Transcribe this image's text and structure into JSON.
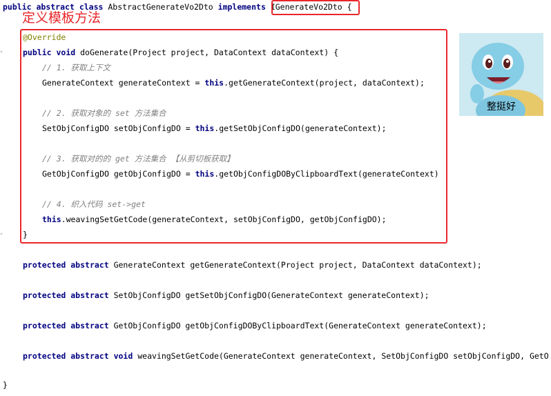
{
  "header": {
    "kw_public": "public",
    "kw_abstract": "abstract",
    "kw_class": "class",
    "class_name": "AbstractGenerateVo2Dto",
    "kw_implements": "implements",
    "interface_name": "IGenerateVo2Dto {"
  },
  "annotation_label": "定义模板方法",
  "method": {
    "override": "@Override",
    "kw_public": "public",
    "kw_void": "void",
    "signature": "doGenerate(Project project, DataContext dataContext) {",
    "comment1": "// 1. 获取上下文",
    "line1_type": "GenerateContext generateContext = ",
    "line1_this": "this",
    "line1_rest": ".getGenerateContext(project, dataContext);",
    "comment2": "// 2. 获取对象的 set 方法集合",
    "line2_type": "SetObjConfigDO setObjConfigDO = ",
    "line2_this": "this",
    "line2_rest": ".getSetObjConfigDO(generateContext);",
    "comment3": "// 3. 获取对的的 get 方法集合 【从剪切板获取】",
    "line3_type": "GetObjConfigDO getObjConfigDO = ",
    "line3_this": "this",
    "line3_rest": ".getObjConfigDOByClipboardText(generateContext)",
    "comment4": "// 4. 织入代码 set->get",
    "line4_this": "this",
    "line4_rest": ".weavingSetGetCode(generateContext, setObjConfigDO, getObjConfigDO);",
    "close": "}"
  },
  "abstract_methods": [
    {
      "kw1": "protected",
      "kw2": "abstract",
      "rest": "GenerateContext getGenerateContext(Project project, DataContext dataContext);"
    },
    {
      "kw1": "protected",
      "kw2": "abstract",
      "rest": "SetObjConfigDO getSetObjConfigDO(GenerateContext generateContext);"
    },
    {
      "kw1": "protected",
      "kw2": "abstract",
      "rest": "GetObjConfigDO getObjConfigDOByClipboardText(GenerateContext generateContext);"
    },
    {
      "kw1": "protected",
      "kw2": "abstract",
      "kw3": "void",
      "rest": "weavingSetGetCode(GenerateContext generateContext, SetObjConfigDO setObjConfigDO, GetO"
    }
  ],
  "class_close": "}",
  "meme": {
    "caption": "整挺好",
    "icon": "squirtle-image"
  },
  "colors": {
    "keyword": "#000080",
    "comment": "#808080",
    "annotation": "#808000",
    "highlight_box": "#e8262b"
  }
}
